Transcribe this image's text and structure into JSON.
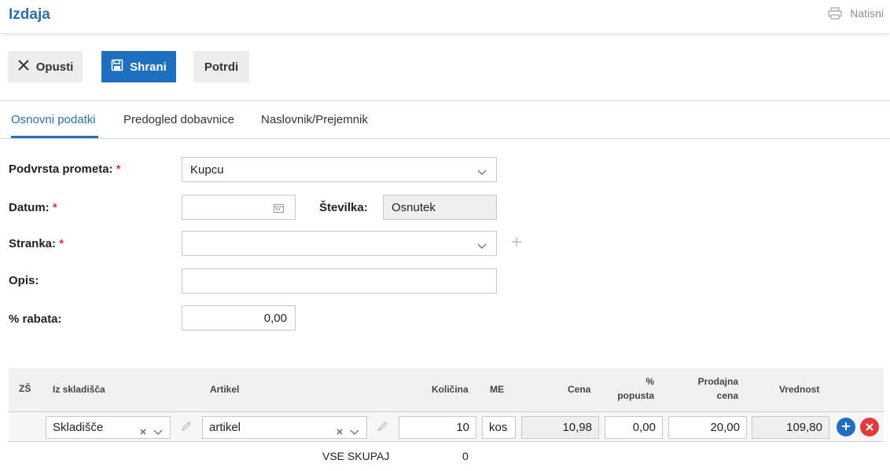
{
  "header": {
    "title": "Izdaja",
    "print_label": "Natisni"
  },
  "toolbar": {
    "cancel_label": "Opusti",
    "save_label": "Shrani",
    "confirm_label": "Potrdi"
  },
  "tabs": [
    {
      "label": "Osnovni podatki",
      "active": true
    },
    {
      "label": "Predogled dobavnice",
      "active": false
    },
    {
      "label": "Naslovnik/Prejemnik",
      "active": false
    }
  ],
  "form": {
    "subtype": {
      "label": "Podvrsta prometa:",
      "required": "*",
      "value": "Kupcu"
    },
    "date": {
      "label": "Datum:",
      "required": "*",
      "value": ""
    },
    "number": {
      "label": "Številka:",
      "value": "Osnutek"
    },
    "partner": {
      "label": "Stranka:",
      "required": "*",
      "value": ""
    },
    "description": {
      "label": "Opis:",
      "value": ""
    },
    "discount": {
      "label": "% rabata:",
      "value": "0,00"
    }
  },
  "table": {
    "headers": {
      "zs": "ZŠ",
      "warehouse": "Iz skladišča",
      "article": "Artikel",
      "quantity": "Količina",
      "unit": "ME",
      "price": "Cena",
      "discount_1": "%",
      "discount_2": "popusta",
      "sale_price_1": "Prodajna",
      "sale_price_2": "cena",
      "value": "Vrednost"
    },
    "row": {
      "warehouse": "Skladišče",
      "article": "artikel",
      "quantity": "10",
      "unit": "kos",
      "price": "10,98",
      "discount": "0,00",
      "sale_price": "20,00",
      "value": "109,80"
    },
    "total_label": "VSE SKUPAJ",
    "total_value": "0"
  },
  "colors": {
    "accent": "#2a6fb0",
    "primary_button": "#1e6fbf",
    "required": "#d9363e",
    "add_button": "#1e6fbf",
    "remove_button": "#e03b3b"
  }
}
